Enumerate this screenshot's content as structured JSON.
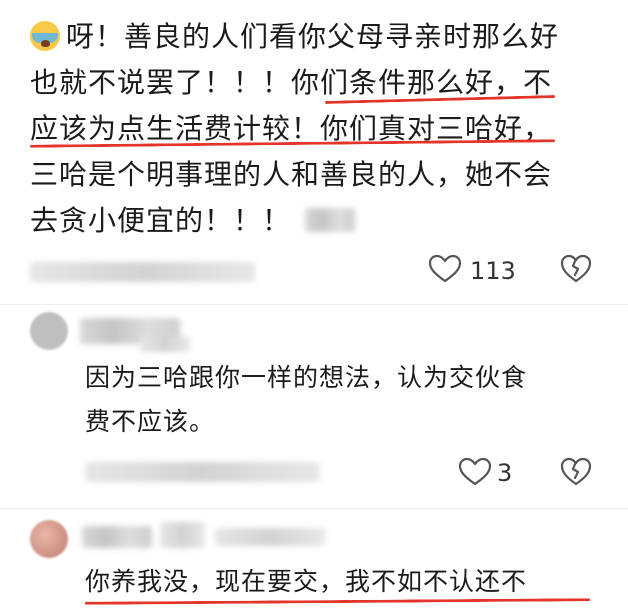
{
  "main_comment": {
    "lines": [
      "呀！善良的人们看你父母寻亲时那么好",
      "也就不说罢了！！！你们条件那么好，不",
      "应该为点生活费计较！你们真对三哈好，",
      "三哈是个明事理的人和善良的人，她不会",
      "去贪小便宜的！！！"
    ],
    "emoji_icon": "crying-face-icon",
    "like_count": "113"
  },
  "reply_1": {
    "lines": [
      "因为三哈跟你一样的想法，认为交伙食",
      "费不应该。"
    ],
    "like_count": "3"
  },
  "reply_2": {
    "lines": [
      "你养我没，现在要交，我不如不认还不"
    ]
  },
  "icons": {
    "like": "heart-outline-icon",
    "dislike": "broken-heart-icon"
  },
  "colors": {
    "underline": "#e4352b",
    "text": "#1b1b1b",
    "icon": "#555555"
  }
}
